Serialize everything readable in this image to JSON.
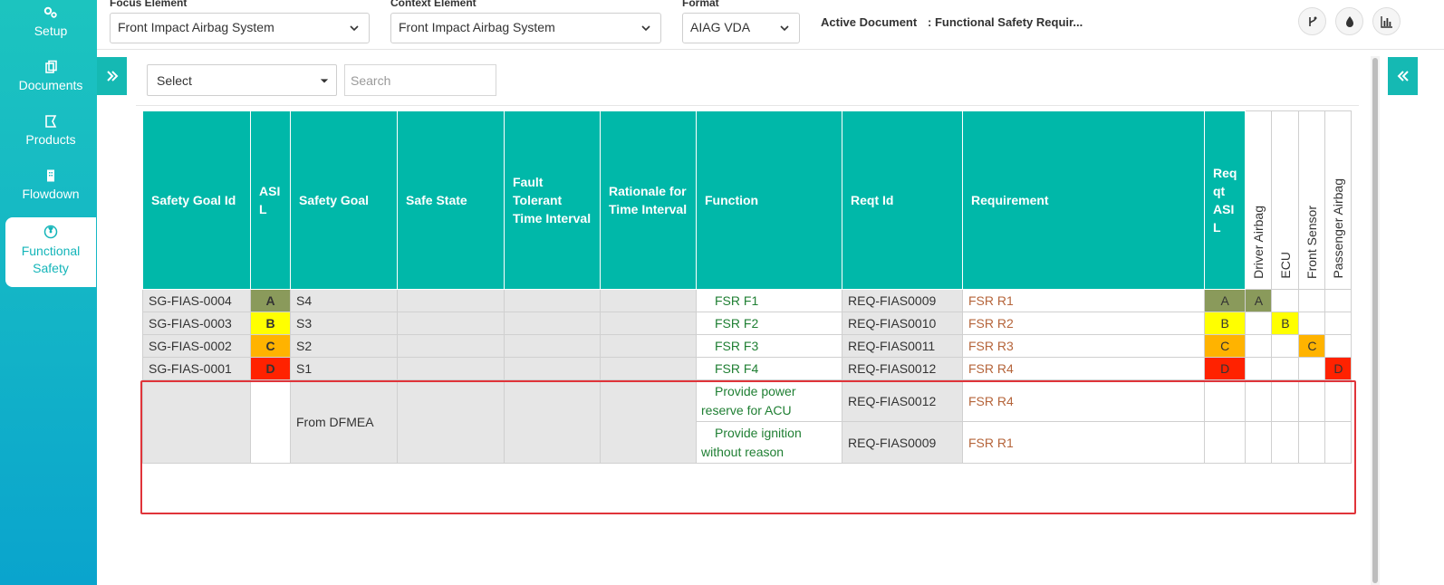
{
  "sidebar": {
    "items": [
      {
        "label": "Setup"
      },
      {
        "label": "Documents"
      },
      {
        "label": "Products"
      },
      {
        "label": "Flowdown"
      },
      {
        "label": "Functional Safety"
      }
    ]
  },
  "topbar": {
    "focus_label": "Focus Element",
    "focus_value": "Front Impact Airbag System",
    "context_label": "Context Element",
    "context_value": "Front Impact Airbag System",
    "format_label": "Format",
    "format_value": "AIAG VDA",
    "active_doc_label": "Active Document",
    "active_doc_value": ": Functional Safety Requir..."
  },
  "filters": {
    "select_value": "Select",
    "search_placeholder": "Search"
  },
  "colors": {
    "asil_A": "#8a9a5b",
    "asil_B": "#ffff00",
    "asil_C": "#ffb300",
    "asil_D": "#ff2200",
    "header": "#00b8a9"
  },
  "table": {
    "headers": {
      "safety_goal_id": "Safety Goal Id",
      "asil": "ASI L",
      "safety_goal": "Safety Goal",
      "safe_state": "Safe State",
      "ftti": "Fault Tolerant Time Interval",
      "rationale": "Rationale for Time Interval",
      "function": "Function",
      "reqt_id": "Reqt Id",
      "requirement": "Requirement",
      "reqt_asil": "Req qt ASI L"
    },
    "alloc_headers": [
      "Driver Airbag",
      "ECU",
      "Front Sensor",
      "Passenger Airbag"
    ],
    "rows": [
      {
        "sg_id": "SG-FIAS-0004",
        "asil": "A",
        "goal": "S4",
        "function": "FSR F1",
        "reqt_id": "REQ-FIAS0009",
        "requirement": "FSR R1",
        "reqt_asil": "A",
        "alloc": [
          "A",
          "",
          "",
          ""
        ]
      },
      {
        "sg_id": "SG-FIAS-0003",
        "asil": "B",
        "goal": "S3",
        "function": "FSR F2",
        "reqt_id": "REQ-FIAS0010",
        "requirement": "FSR R2",
        "reqt_asil": "B",
        "alloc": [
          "",
          "B",
          "",
          ""
        ]
      },
      {
        "sg_id": "SG-FIAS-0002",
        "asil": "C",
        "goal": "S2",
        "function": "FSR F3",
        "reqt_id": "REQ-FIAS0011",
        "requirement": "FSR R3",
        "reqt_asil": "C",
        "alloc": [
          "",
          "",
          "C",
          ""
        ]
      },
      {
        "sg_id": "SG-FIAS-0001",
        "asil": "D",
        "goal": "S1",
        "function": "FSR F4",
        "reqt_id": "REQ-FIAS0012",
        "requirement": "FSR R4",
        "reqt_asil": "D",
        "alloc": [
          "",
          "",
          "",
          "D"
        ]
      }
    ],
    "dfmea": {
      "goal": "From DFMEA",
      "items": [
        {
          "function": "Provide power reserve for ACU",
          "reqt_id": "REQ-FIAS0012",
          "requirement": "FSR R4"
        },
        {
          "function": "Provide ignition without reason",
          "reqt_id": "REQ-FIAS0009",
          "requirement": "FSR R1"
        }
      ]
    }
  }
}
